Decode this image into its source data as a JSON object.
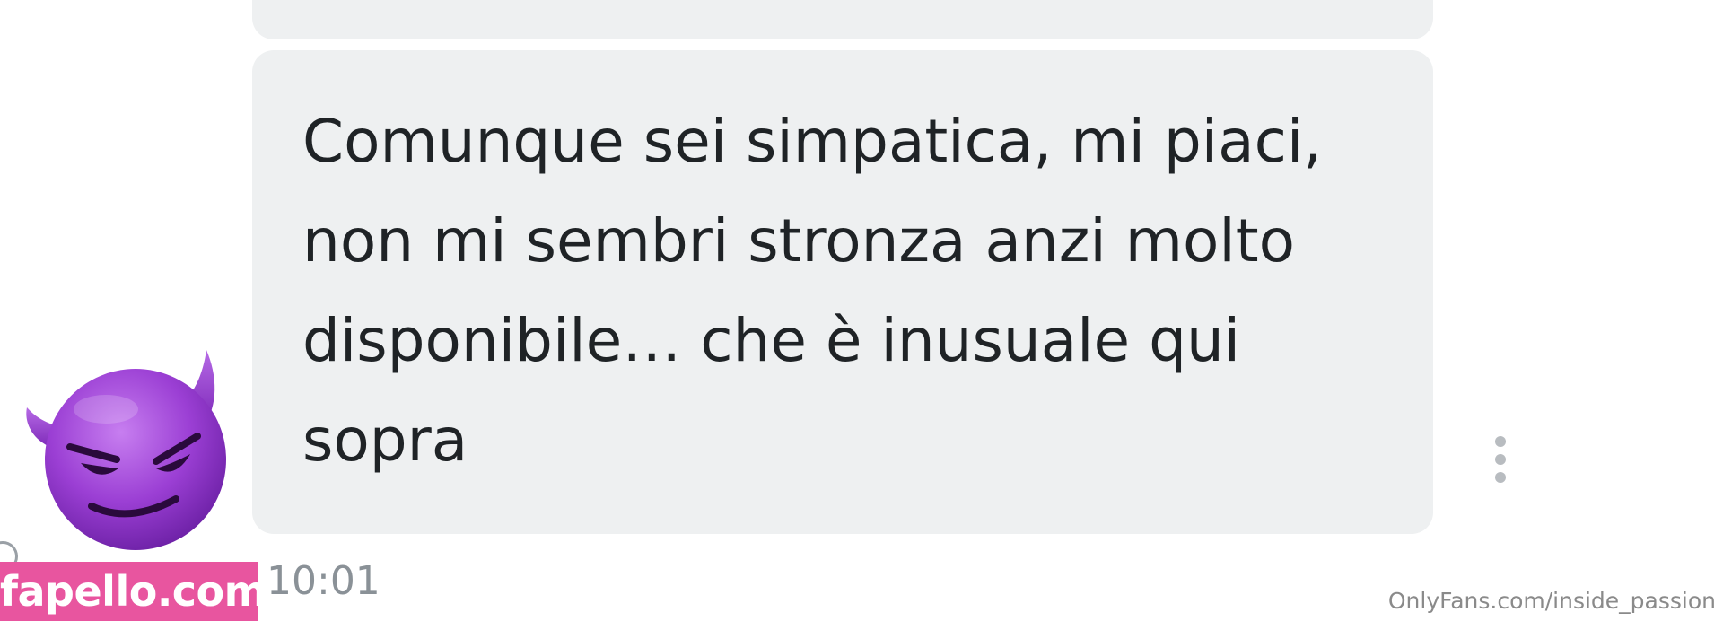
{
  "chat": {
    "message_text": "Comunque sei simpatica, mi piaci,\nnon mi sembri stronza anzi molto\ndisponibile… che è inusuale qui\nsopra",
    "timestamp": "10:01",
    "more_icon": "vertical-dots-icon",
    "avatar_icon": "smiling-devil-emoji-icon"
  },
  "watermarks": {
    "site": "fapello.com",
    "source": "OnlyFans.com/inside_passion"
  },
  "colors": {
    "bubble": "#eef0f1",
    "text": "#1f2326",
    "timestamp": "#8a9197",
    "emoji_purple": "#9b3fd4",
    "watermark_pink": "#e8559f"
  }
}
